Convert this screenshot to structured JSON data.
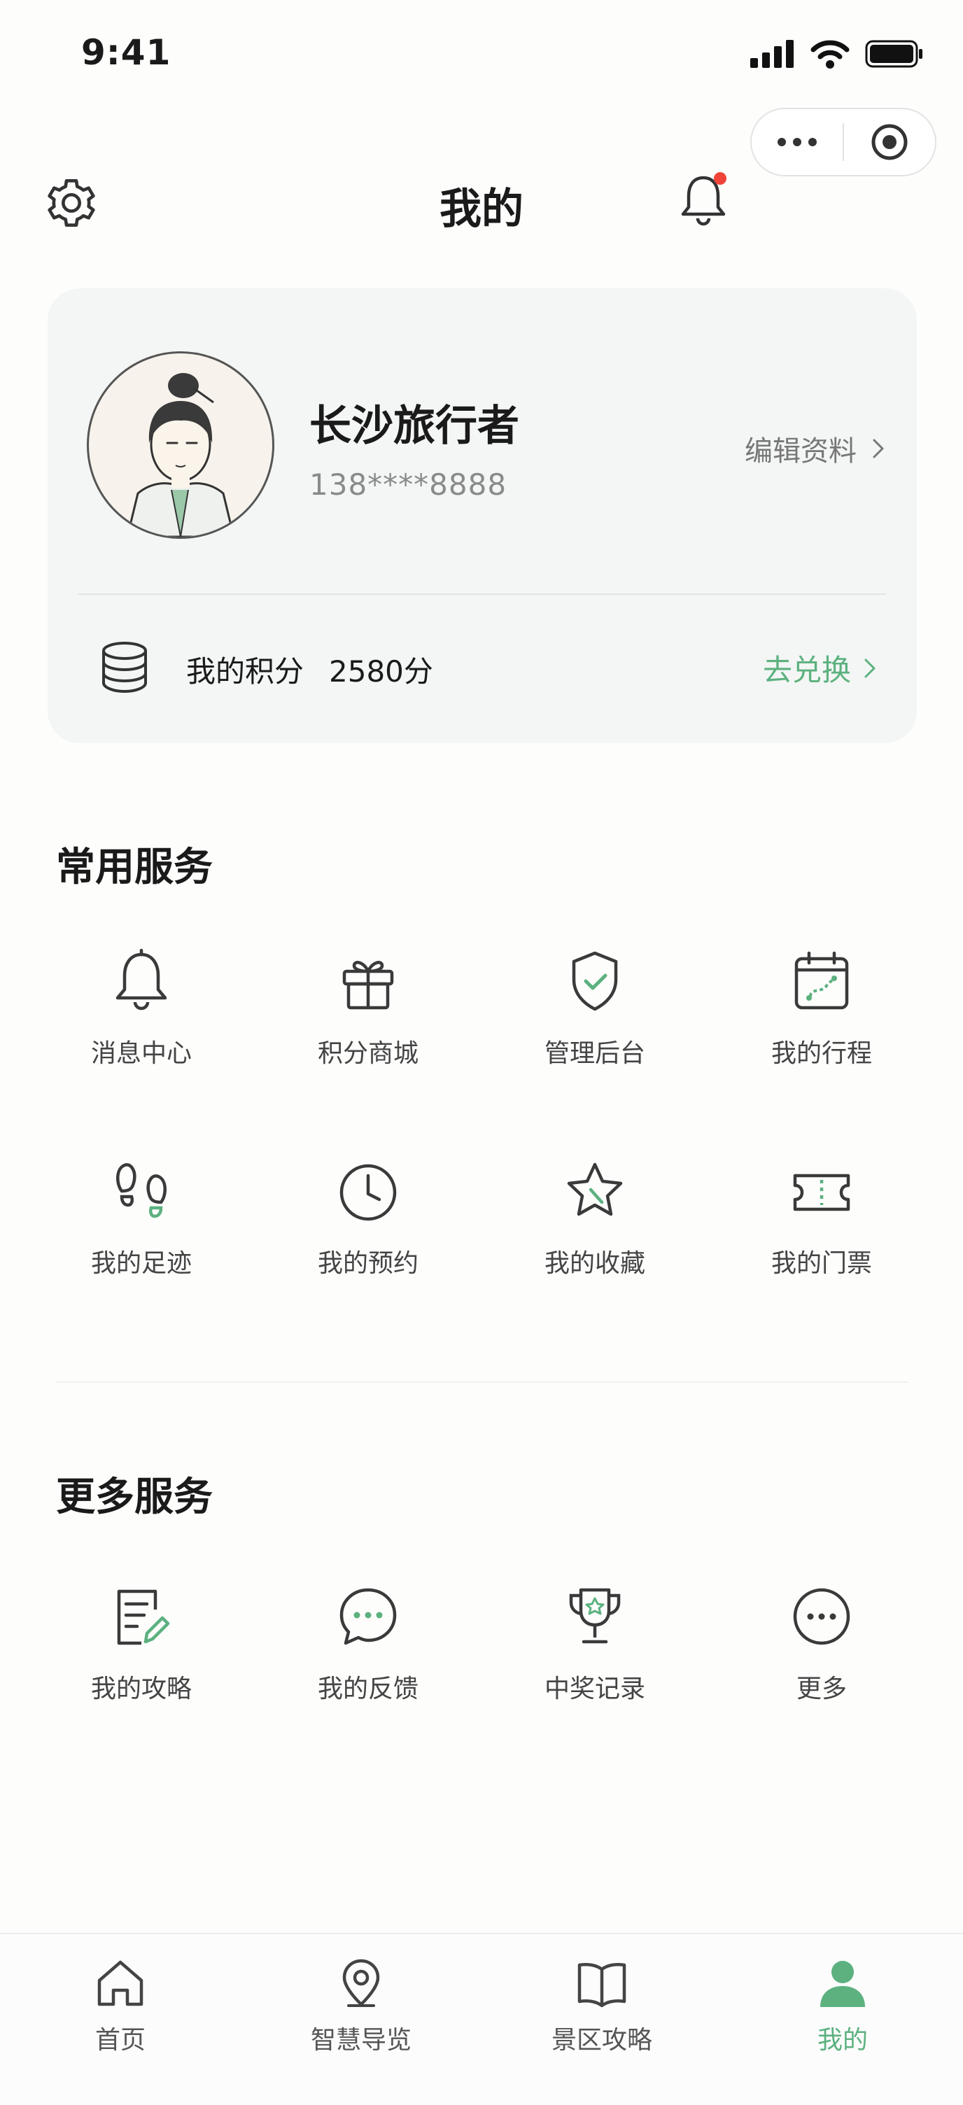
{
  "status_bar": {
    "time": "9:41"
  },
  "header": {
    "title": "我的"
  },
  "profile": {
    "nickname": "长沙旅行者",
    "phone": "138****8888",
    "edit_label": "编辑资料",
    "points_label": "我的积分",
    "points_value": "2580分",
    "exchange_label": "去兑换"
  },
  "common_services": {
    "title": "常用服务",
    "items": [
      {
        "label": "消息中心",
        "icon": "bell-icon"
      },
      {
        "label": "积分商城",
        "icon": "gift-icon"
      },
      {
        "label": "管理后台",
        "icon": "shield-check-icon"
      },
      {
        "label": "我的行程",
        "icon": "calendar-route-icon"
      },
      {
        "label": "我的足迹",
        "icon": "footprints-icon"
      },
      {
        "label": "我的预约",
        "icon": "clock-icon"
      },
      {
        "label": "我的收藏",
        "icon": "star-icon"
      },
      {
        "label": "我的门票",
        "icon": "ticket-icon"
      }
    ]
  },
  "more_services": {
    "title": "更多服务",
    "items": [
      {
        "label": "我的攻略",
        "icon": "note-edit-icon"
      },
      {
        "label": "我的反馈",
        "icon": "chat-bubble-icon"
      },
      {
        "label": "中奖记录",
        "icon": "trophy-icon"
      },
      {
        "label": "更多",
        "icon": "more-icon"
      }
    ]
  },
  "tab_bar": {
    "items": [
      {
        "label": "首页",
        "icon": "home-icon",
        "active": false
      },
      {
        "label": "智慧导览",
        "icon": "location-icon",
        "active": false
      },
      {
        "label": "景区攻略",
        "icon": "book-icon",
        "active": false
      },
      {
        "label": "我的",
        "icon": "user-icon",
        "active": true
      }
    ]
  },
  "colors": {
    "accent": "#5cb17f",
    "icon_stroke": "#3a3a3a",
    "badge": "#f04438",
    "card_bg": "#f3f6f4"
  }
}
